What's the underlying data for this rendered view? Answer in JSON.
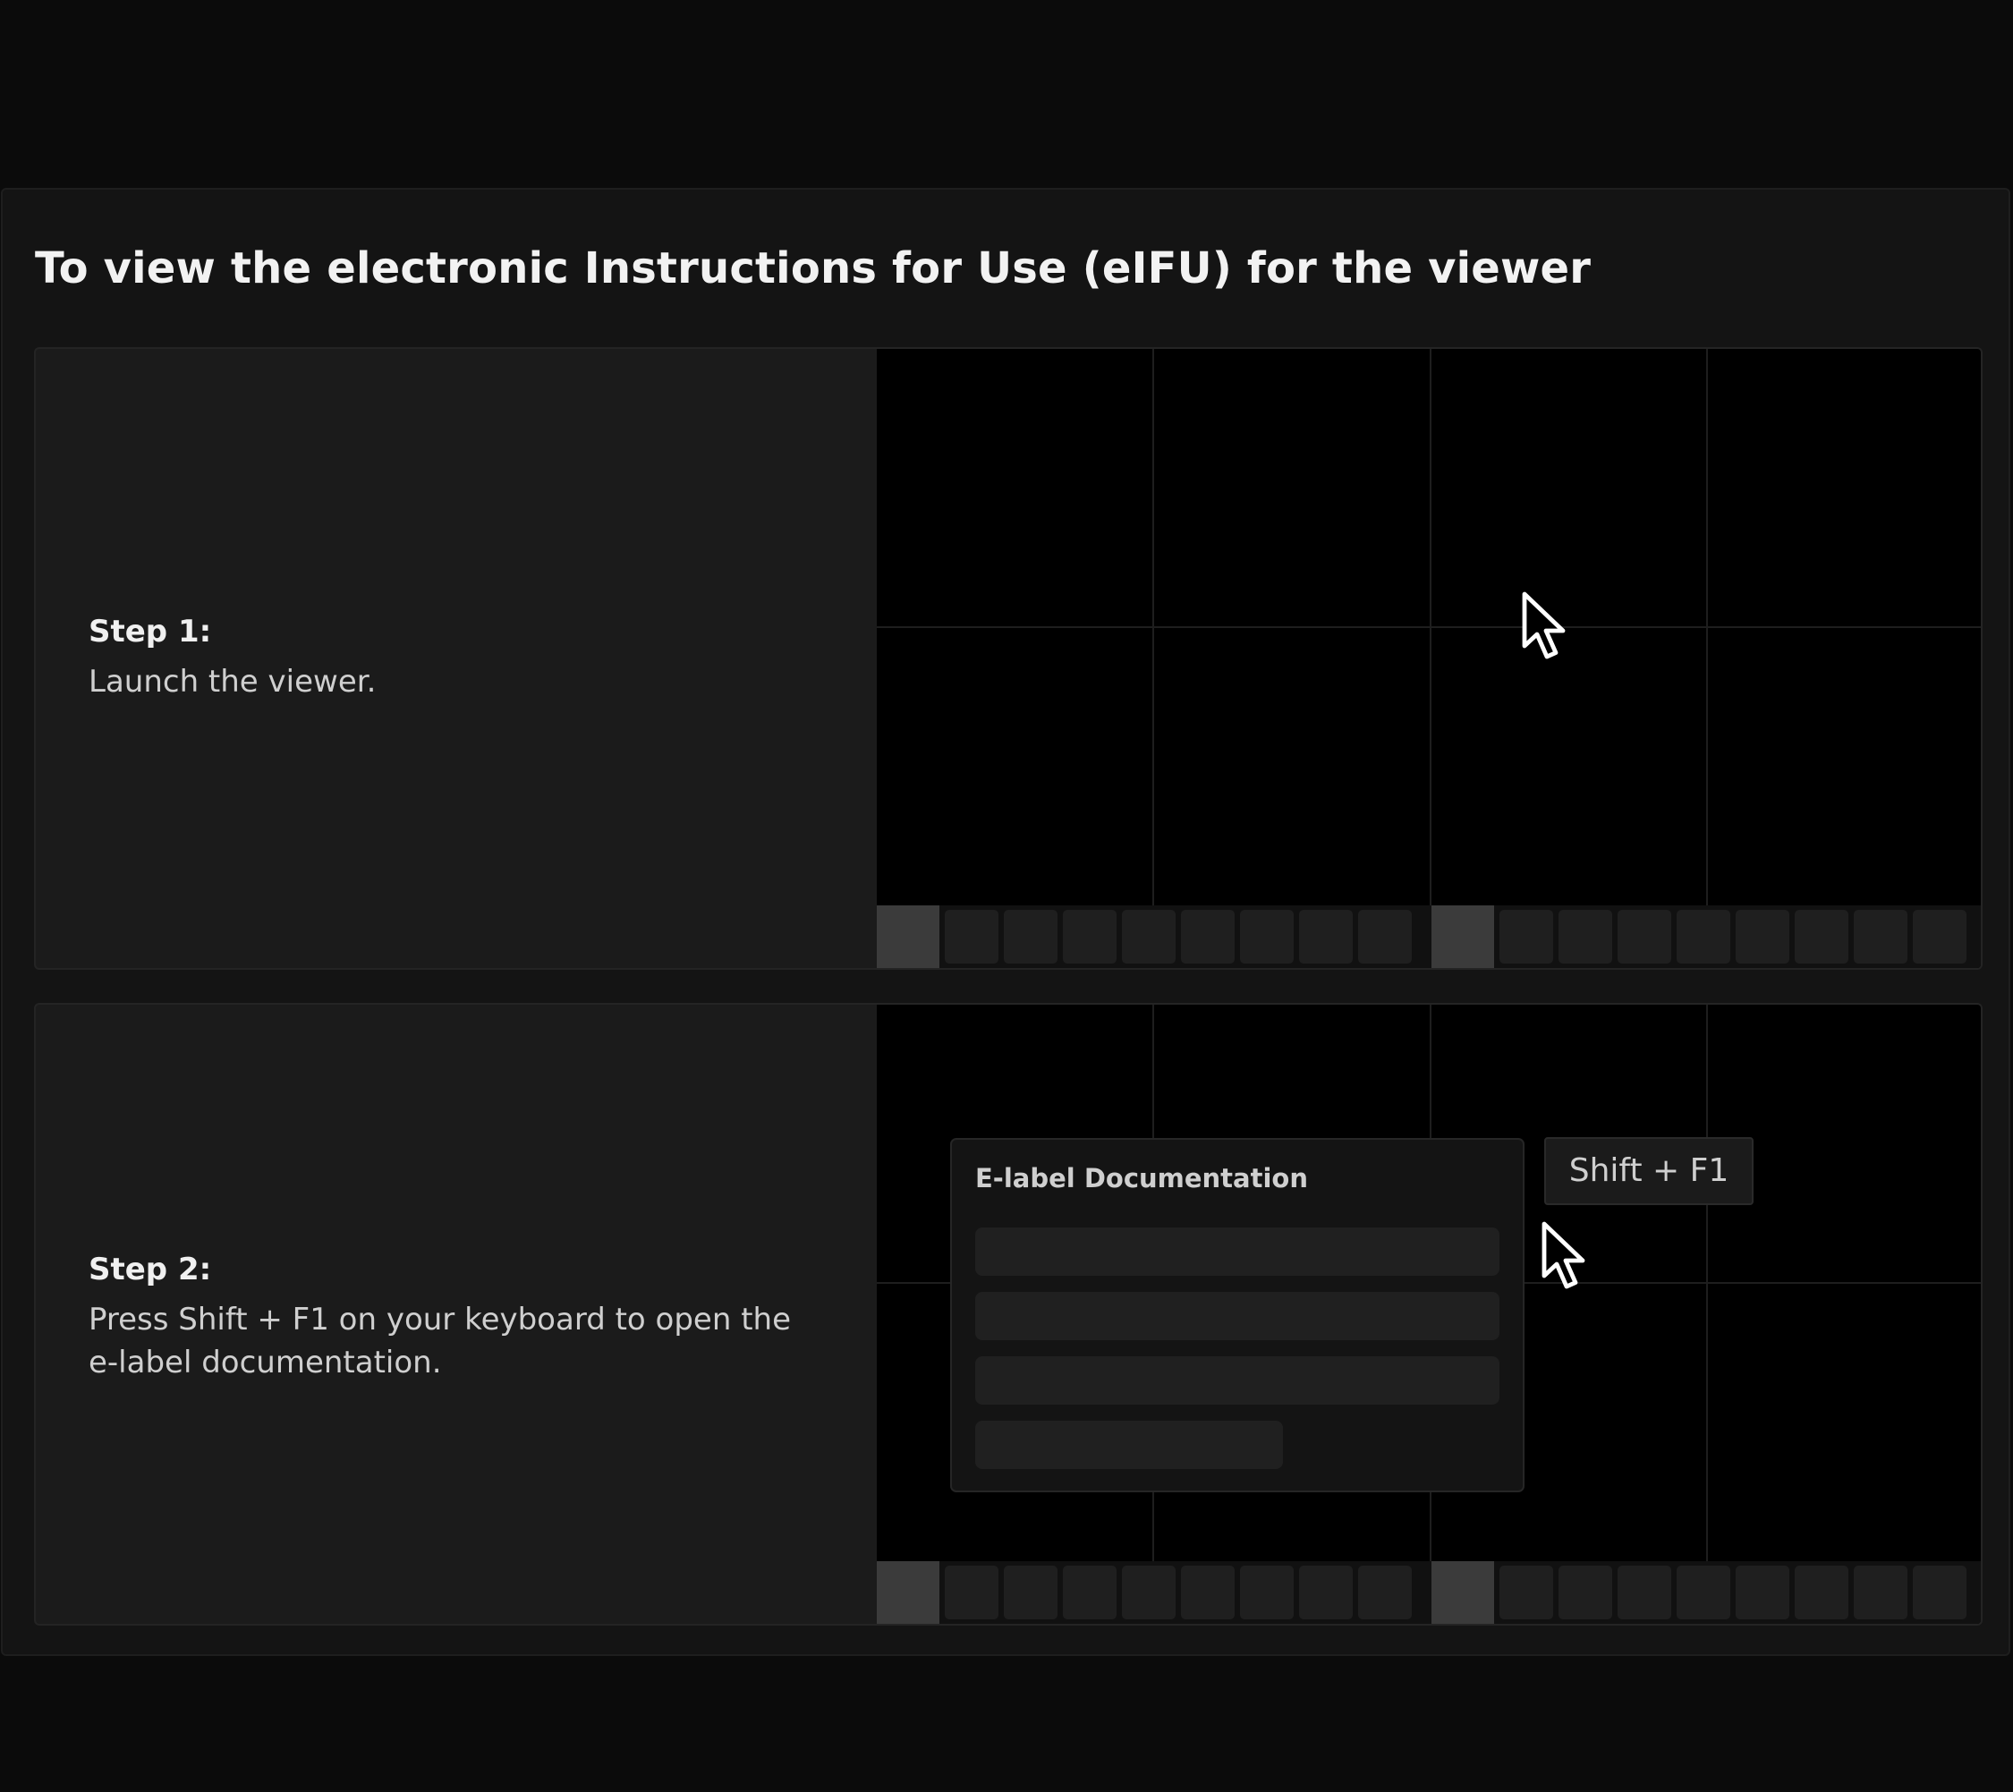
{
  "page": {
    "title": "To view the electronic Instructions for Use (eIFU) for the viewer"
  },
  "steps": [
    {
      "label": "Step 1:",
      "description": "Launch the viewer."
    },
    {
      "label": "Step 2:",
      "description": "Press Shift + F1 on your keyboard to open the e-label documentation."
    }
  ],
  "popup": {
    "title": "E-label Documentation"
  },
  "shortcut": {
    "label": "Shift + F1"
  },
  "icons": {
    "cursor": "mouse-pointer-icon"
  },
  "colors": {
    "background": "#0b0b0b",
    "panel": "#141414",
    "card": "#1b1b1b",
    "viewer": "#000000",
    "active_thumbnail": "#3b3b3b",
    "text_primary": "#f2f2f2",
    "text_secondary": "#cfcfcf"
  }
}
